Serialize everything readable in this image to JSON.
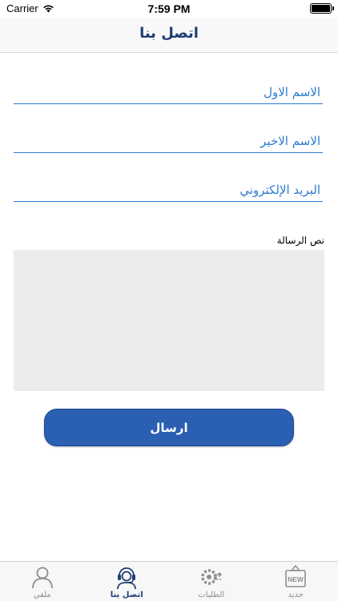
{
  "status_bar": {
    "carrier": "Carrier",
    "time": "7:59 PM"
  },
  "nav": {
    "title": "اتصل بنا"
  },
  "form": {
    "first_name_placeholder": "الاسم الاول",
    "last_name_placeholder": "الاسم الاخير",
    "email_placeholder": "البريد الإلكتروني",
    "message_label": "نص الرسالة",
    "submit_label": "ارسال"
  },
  "tabs": [
    {
      "label": "ملفي",
      "icon": "profile-icon",
      "active": false
    },
    {
      "label": "اتصل بنا",
      "icon": "support-agent-icon",
      "active": true
    },
    {
      "label": "الطلبات",
      "icon": "orders-gear-icon",
      "active": false
    },
    {
      "label": "جديد",
      "icon": "new-badge-icon",
      "active": false
    }
  ],
  "colors": {
    "accent": "#2b5fb2",
    "title": "#1f3e73",
    "field_line": "#2b7bd0"
  }
}
